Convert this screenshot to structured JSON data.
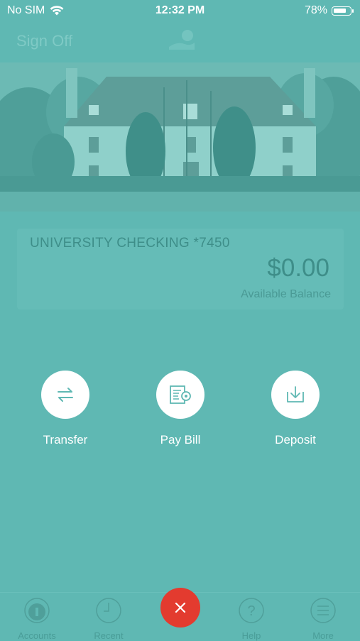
{
  "status_bar": {
    "carrier": "No SIM",
    "time": "12:32 PM",
    "battery": "78%",
    "battery_level": 0.78
  },
  "header": {
    "sign_off_label": "Sign Off"
  },
  "account": {
    "name": "UNIVERSITY CHECKING *7450",
    "balance": "$0.00",
    "balance_label": "Available Balance"
  },
  "actions": [
    {
      "label": "Transfer",
      "icon": "transfer-icon"
    },
    {
      "label": "Pay Bill",
      "icon": "pay-bill-icon"
    },
    {
      "label": "Deposit",
      "icon": "deposit-icon"
    }
  ],
  "tabbar": {
    "items": [
      {
        "label": "Accounts",
        "icon": "accounts-icon"
      },
      {
        "label": "Recent",
        "icon": "clock-icon"
      },
      {
        "label": "Help",
        "icon": "help-icon"
      },
      {
        "label": "More",
        "icon": "menu-icon"
      }
    ],
    "close_icon": "close-icon"
  },
  "colors": {
    "overlay_teal": "#5fb8b3",
    "close_red": "#e33b2f",
    "white": "#ffffff"
  }
}
